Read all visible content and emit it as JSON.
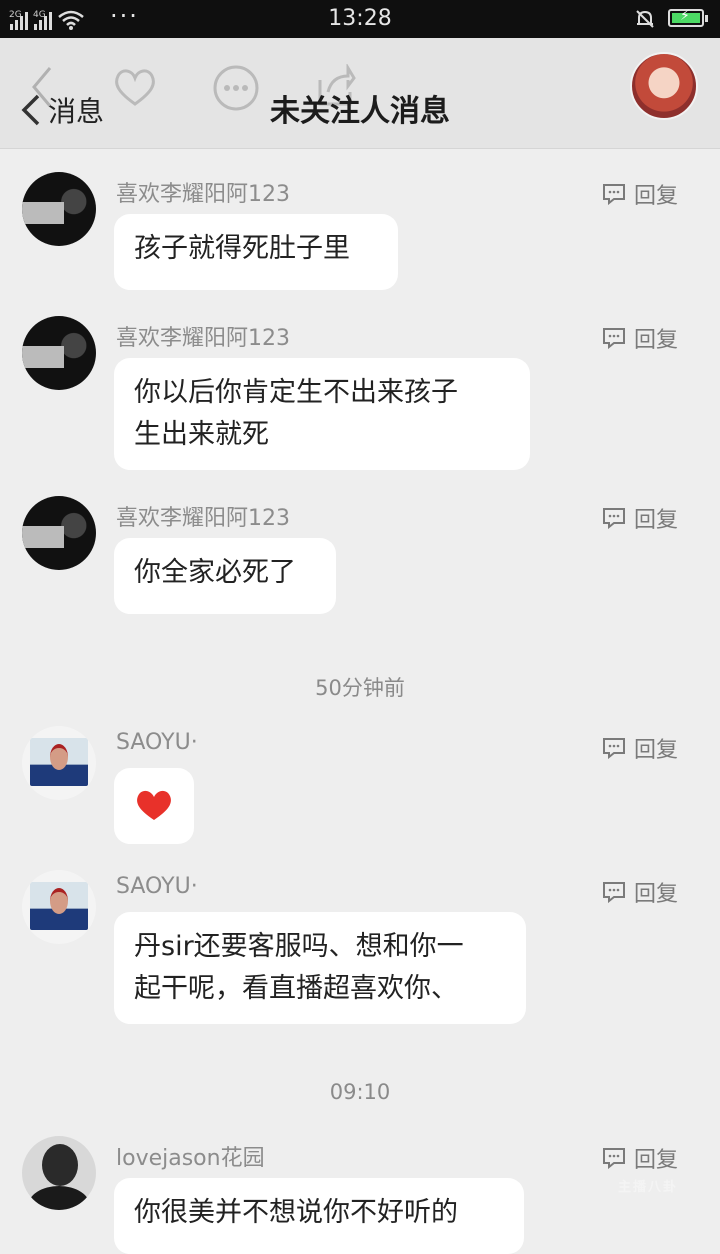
{
  "status_bar": {
    "network_1": "2G",
    "network_2": "4G",
    "dots": "···",
    "time": "13:28"
  },
  "header": {
    "back_label": "消息",
    "title": "未关注人消息"
  },
  "messages": [
    {
      "name": "喜欢李耀阳阿123",
      "text": "孩子就得死肚子里",
      "reply": "回复"
    },
    {
      "name": "喜欢李耀阳阿123",
      "line1": "你以后你肯定生不出来孩子",
      "line2": "生出来就死",
      "reply": "回复"
    },
    {
      "name": "喜欢李耀阳阿123",
      "text": "你全家必死了",
      "reply": "回复"
    },
    {
      "name": "SAOYU·",
      "text": "❤️",
      "reply": "回复"
    },
    {
      "name": "SAOYU·",
      "line1": "丹sir还要客服吗、想和你一",
      "line2": "起干呢，看直播超喜欢你、",
      "reply": "回复"
    },
    {
      "name": "lovejason花园",
      "text": "你很美并不想说你不好听的",
      "reply": "回复"
    }
  ],
  "timestamps": [
    "50分钟前",
    "09:10"
  ],
  "watermark": "主播八卦",
  "colors": {
    "heart": "#e8312a",
    "battery": "#4cd964"
  }
}
